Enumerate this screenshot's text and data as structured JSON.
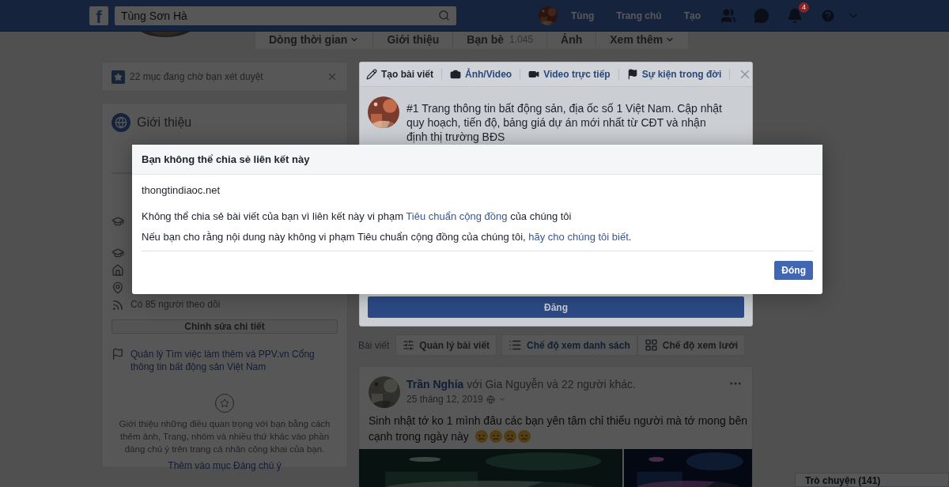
{
  "top_bar": {
    "logo": "f",
    "search": {
      "value": "Tùng Sơn Hà"
    },
    "user": "Tùng",
    "nav": [
      "Trang chủ",
      "Tạo"
    ],
    "notification_count": "4"
  },
  "profile_tabs": [
    {
      "label": "Dòng thời gian",
      "dropdown": true
    },
    {
      "label": "Giới thiệu",
      "dropdown": false
    },
    {
      "label": "Bạn bè",
      "count": "1.045",
      "dropdown": false
    },
    {
      "label": "Ảnh",
      "dropdown": false
    },
    {
      "label": "Xem thêm",
      "dropdown": true
    }
  ],
  "review_notice": {
    "text": "22 mục đang chờ bạn xét duyệt"
  },
  "intro": {
    "title": "Giới thiệu",
    "details": [
      {
        "kind": "school"
      },
      {
        "kind": "school"
      },
      {
        "kind": "home"
      },
      {
        "kind": "location"
      },
      {
        "kind": "followers",
        "text": "Có 85 người theo dõi"
      }
    ],
    "edit_button": "Chỉnh sửa chi tiết",
    "managed_page": "Quản lý Tìm việc làm thêm và PPV.vn Cổng thông tin bất động sản Việt Nam",
    "featured": {
      "text": "Giới thiệu những điều quan trọng với bạn bằng cách thêm ảnh, Trang, nhóm và nhiều thứ khác vào phần đáng chú ý trên trang cá nhân công khai của bạn.",
      "link": "Thêm vào mục Đáng chú ý"
    }
  },
  "composer": {
    "tabs": [
      {
        "kind": "write",
        "label": "Tạo bài viết",
        "selected": true
      },
      {
        "label": "Ảnh/Video",
        "selected": false
      },
      {
        "kind": "live",
        "label": "Video trực tiếp",
        "selected": false
      },
      {
        "kind": "event",
        "label": "Sự kiện trong đời",
        "selected": false
      }
    ],
    "text": "#1 Trang thông tin bất động sản, địa ốc số 1 Việt Nam. Cập nhật quy hoạch, tiến độ, bảng giá dự án mới nhất từ CĐT và nhận định thị trường BĐS",
    "post_button": "Đăng"
  },
  "posts_filter": {
    "label": "Bài viết",
    "manage_button": "Quản lý bài viết",
    "views": [
      {
        "kind": "list",
        "label": "Chế độ xem danh sách",
        "selected": true
      },
      {
        "kind": "grid",
        "label": "Chế độ xem lưới",
        "selected": false
      }
    ]
  },
  "post": {
    "author": "Trần Nghia",
    "with_text": "với Gia Nguyễn và 22 người khác.",
    "date": "25 tháng 12, 2019",
    "text_lines": [
      "Sinh nhật tớ ko 1 mình đâu các bạn yên tâm chỉ thiếu người mà tớ mong bên",
      "cạnh trong ngày này"
    ],
    "emojis": [
      {
        "kind": "sad"
      },
      {
        "kind": "sad"
      },
      {
        "kind": "sad"
      },
      {
        "kind": "sad"
      }
    ]
  },
  "chat": {
    "label": "Trò chuyện (141)"
  },
  "modal": {
    "title": "Bạn không thể chia sẻ liên kết này",
    "domain": "thongtindiaoc.net",
    "lines": [
      {
        "before": "Không thể chia sẻ bài viết của bạn vì liên kết này vi phạm ",
        "link": "Tiêu chuẩn cộng đồng",
        "after": " của chúng tôi"
      },
      {
        "before": "Nếu bạn cho rằng nội dung này không vi phạm Tiêu chuẩn cộng đồng của chúng tôi, ",
        "link": "hãy cho chúng tôi biết",
        "after": "."
      }
    ],
    "close_button": "Đóng"
  }
}
